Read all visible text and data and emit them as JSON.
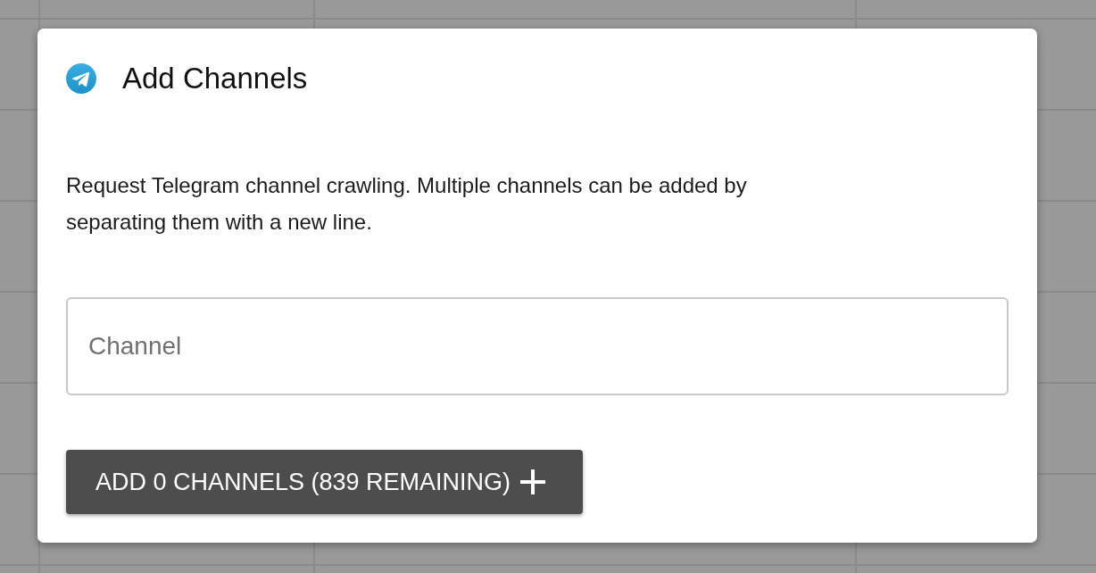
{
  "dialog": {
    "title": "Add Channels",
    "description": "Request Telegram channel crawling. Multiple channels can be added by separating them with a new line.",
    "channel_field": {
      "placeholder": "Channel"
    },
    "submit_button": {
      "label": "ADD 0 CHANNELS (839 REMAINING)"
    }
  }
}
